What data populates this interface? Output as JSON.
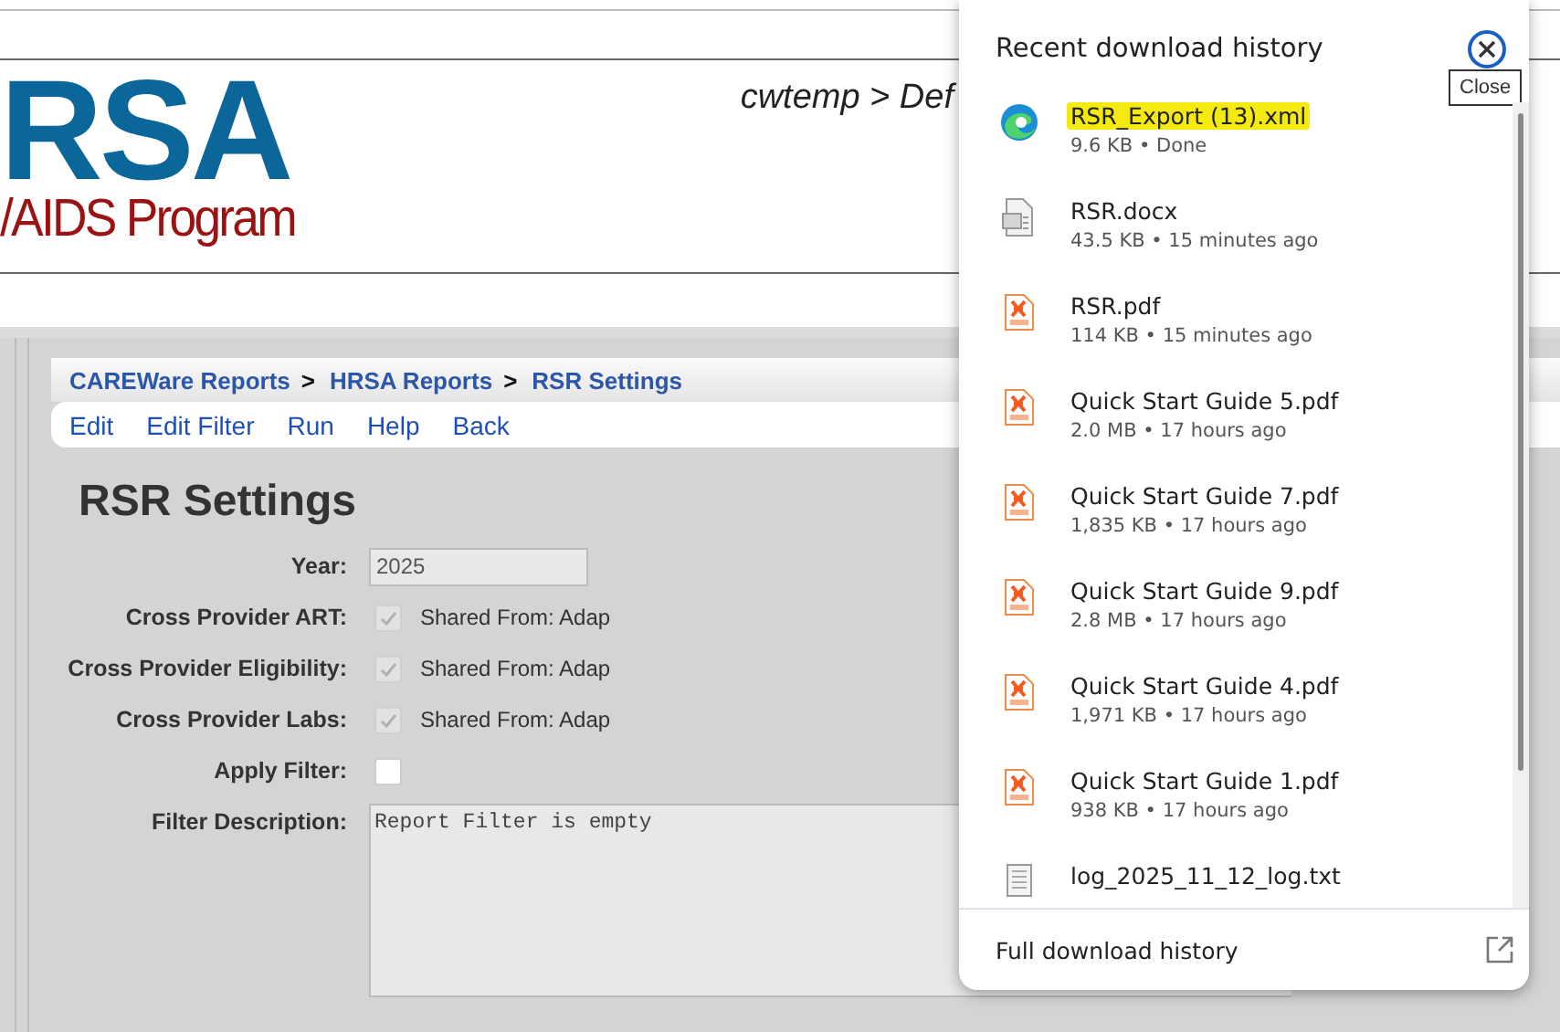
{
  "header": {
    "logo_top": "RSA",
    "logo_bottom": "/AIDS Program",
    "path": "cwtemp > Def"
  },
  "breadcrumb": [
    {
      "label": "CAREWare Reports",
      "separator": ">"
    },
    {
      "label": "HRSA Reports",
      "separator": ">"
    },
    {
      "label": "RSR Settings"
    }
  ],
  "menu": [
    "Edit",
    "Edit Filter",
    "Run",
    "Help",
    "Back"
  ],
  "page_title": "RSR Settings",
  "form": [
    {
      "kind": "text",
      "label": "Year:",
      "value": "2025"
    },
    {
      "kind": "checkbox",
      "label": "Cross Provider ART:",
      "checked": true,
      "disabled": true,
      "note": "Shared From: Adap"
    },
    {
      "kind": "checkbox",
      "label": "Cross Provider Eligibility:",
      "checked": true,
      "disabled": true,
      "note": "Shared From: Adap"
    },
    {
      "kind": "checkbox",
      "label": "Cross Provider Labs:",
      "checked": true,
      "disabled": true,
      "note": "Shared From: Adap"
    },
    {
      "kind": "checkbox",
      "label": "Apply Filter:",
      "checked": false,
      "disabled": false
    },
    {
      "kind": "textarea",
      "label": "Filter Description:",
      "value": "Report Filter is empty"
    }
  ],
  "downloads": {
    "title": "Recent download history",
    "close_tooltip": "Close",
    "items": [
      {
        "kind": "edge",
        "name": "RSR_Export (13).xml",
        "meta": "9.6 KB • Done",
        "highlighted": true
      },
      {
        "kind": "doc",
        "name": "RSR.docx",
        "meta": "43.5 KB • 15 minutes ago",
        "highlighted": false
      },
      {
        "kind": "pdf",
        "name": "RSR.pdf",
        "meta": "114 KB • 15 minutes ago",
        "highlighted": false
      },
      {
        "kind": "pdf",
        "name": "Quick Start Guide 5.pdf",
        "meta": "2.0 MB • 17 hours ago",
        "highlighted": false
      },
      {
        "kind": "pdf",
        "name": "Quick Start Guide 7.pdf",
        "meta": "1,835 KB • 17 hours ago",
        "highlighted": false
      },
      {
        "kind": "pdf",
        "name": "Quick Start Guide 9.pdf",
        "meta": "2.8 MB • 17 hours ago",
        "highlighted": false
      },
      {
        "kind": "pdf",
        "name": "Quick Start Guide 4.pdf",
        "meta": "1,971 KB • 17 hours ago",
        "highlighted": false
      },
      {
        "kind": "pdf",
        "name": "Quick Start Guide 1.pdf",
        "meta": "938 KB • 17 hours ago",
        "highlighted": false
      },
      {
        "kind": "txt",
        "name": "log_2025_11_12_log.txt",
        "highlighted": false
      }
    ],
    "footer": "Full download history"
  }
}
